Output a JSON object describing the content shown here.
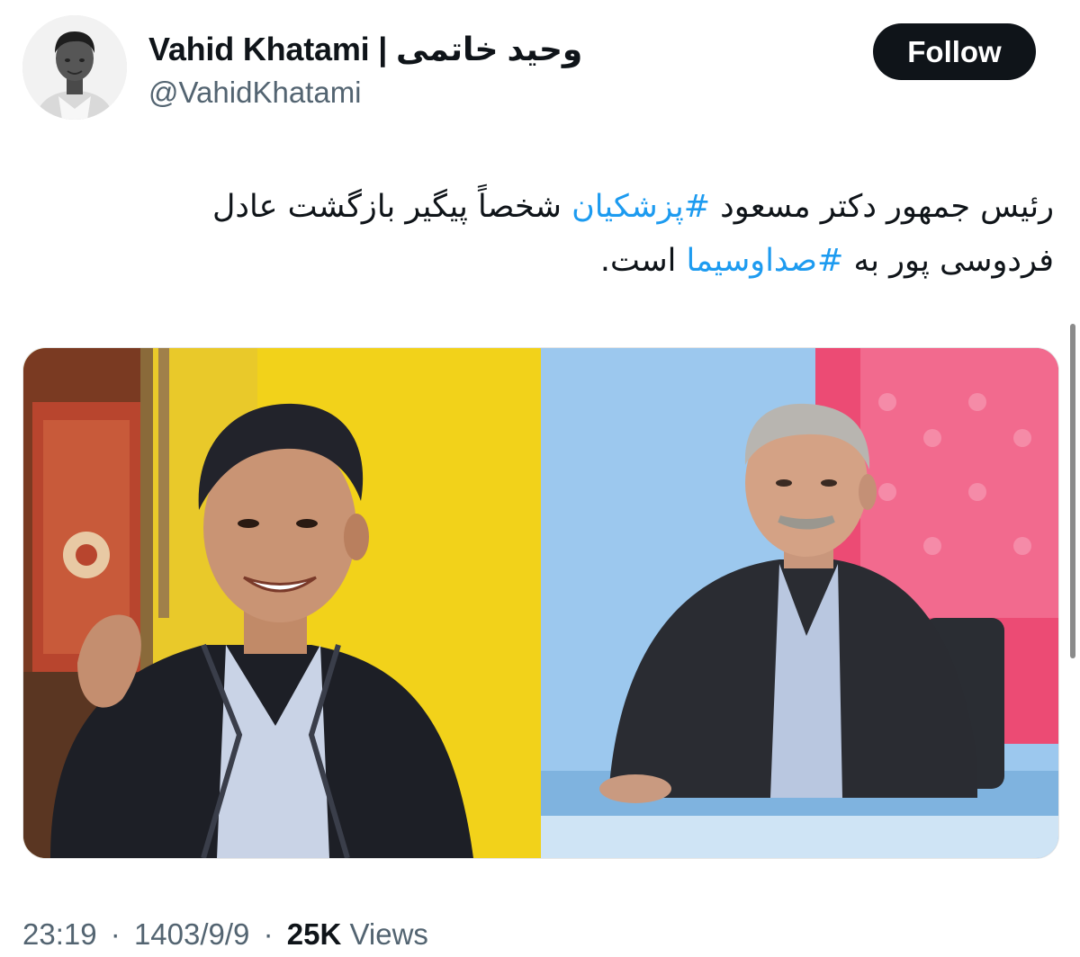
{
  "author": {
    "display_name": "Vahid Khatami | وحید خاتمی",
    "handle": "@VahidKhatami"
  },
  "follow_button": {
    "label": "Follow"
  },
  "tweet": {
    "line1_before": "رئیس جمهور دکتر مسعود ",
    "hashtag1": "#پزشکیان",
    "line1_after": " شخصاً پیگیر بازگشت عادل",
    "line2_before": "فردوسی پور به ",
    "hashtag2": "#صداوسیما",
    "line2_after": " است."
  },
  "media": {
    "left_image": "portrait-man-leather-jacket",
    "right_image": "portrait-older-man-tv-studio"
  },
  "meta": {
    "time": "23:19",
    "separator": "·",
    "date": "1403/9/9",
    "views_count": "25K",
    "views_label": "Views"
  },
  "colors": {
    "hashtag": "#1d9bf0",
    "button_bg": "#0f1419",
    "secondary_text": "#536471"
  }
}
